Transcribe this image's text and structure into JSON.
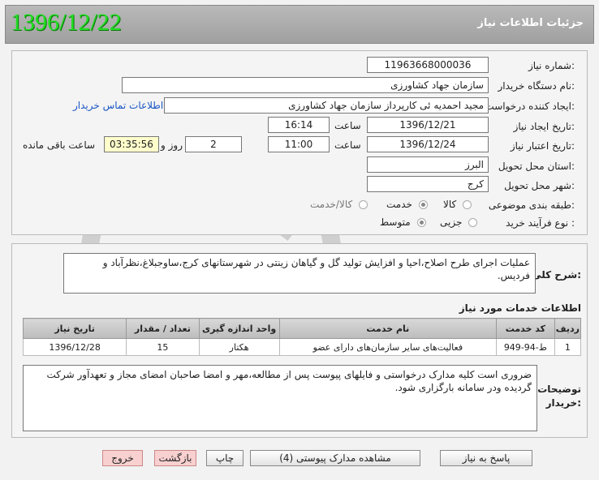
{
  "header": {
    "title": "جزئیات اطلاعات نیاز",
    "date": "1396/12/22"
  },
  "form": {
    "need_number": {
      "label": "شماره نیاز:",
      "value": "1196366800003‍6"
    },
    "buyer_org": {
      "label": "نام دستگاه خریدار:",
      "value": "سازمان جهاد کشاورزی"
    },
    "requester": {
      "label": "ایجاد کننده درخواست:",
      "value": "مجید احمدیه ئی کارپرداز سازمان جهاد کشاورزی",
      "contact_link": "اطلاعات تماس خریدار"
    },
    "created": {
      "label": "تاریخ ایجاد نیاز:",
      "date": "1396/12/21",
      "time_label": "ساعت",
      "time": "16:14"
    },
    "validity": {
      "label": "تاریخ اعتبار نیاز:",
      "date": "1396/12/24",
      "time_label": "ساعت",
      "time": "11:00",
      "days": "2",
      "days_label": "روز و",
      "remaining": "03:35:56",
      "remaining_label": "ساعت باقی مانده"
    },
    "province": {
      "label": "استان محل تحویل:",
      "value": "البرز"
    },
    "city": {
      "label": "شهر محل تحویل:",
      "value": "کرج"
    },
    "category": {
      "label": "طبقه بندی موضوعی:",
      "options": [
        "کالا",
        "خدمت",
        "کالا/خدمت"
      ],
      "selected": "خدمت"
    },
    "process": {
      "label": "نوع فرآیند خرید :",
      "options": [
        "جزیی",
        "متوسط"
      ],
      "selected": "متوسط"
    }
  },
  "description": {
    "label": "شرح کلی نیاز:",
    "text": "عملیات اجرای طرح اصلاح،احیا و افزایش تولید گل و گیاهان زینتی در شهرستانهای کرج،ساوجبلاغ،نظرآباد و فردیس."
  },
  "services": {
    "title": "اطلاعات خدمات مورد نیاز",
    "columns": [
      "ردیف",
      "کد خدمت",
      "نام خدمت",
      "واحد اندازه گیری",
      "تعداد / مقدار",
      "تاریخ نیاز"
    ],
    "rows": [
      [
        "1",
        "ط-94-949",
        "فعالیت‌های سایر سازمان‌های دارای عضو",
        "هکتار",
        "15",
        "1396/12/28"
      ]
    ]
  },
  "buyer_notes": {
    "label": "توضیحات خریدار:",
    "text": "ضروری است کلیه مدارک درخواستی و فایلهای پیوست پس از مطالعه،مهر و امضا صاحبان امضای مجاز و تعهدآور شرکت گردیده ودر سامانه بارگزاری شود."
  },
  "buttons": {
    "reply": "پاسخ به نیاز",
    "attachments": "مشاهده مدارک پیوستی (4)",
    "print": "چاپ",
    "back": "بازگشت",
    "exit": "خروج"
  },
  "colors": {
    "header_bg": "#a8a8a8",
    "date_green": "#22dd22",
    "highlight": "#ffffcc",
    "link": "#1a56c4"
  }
}
